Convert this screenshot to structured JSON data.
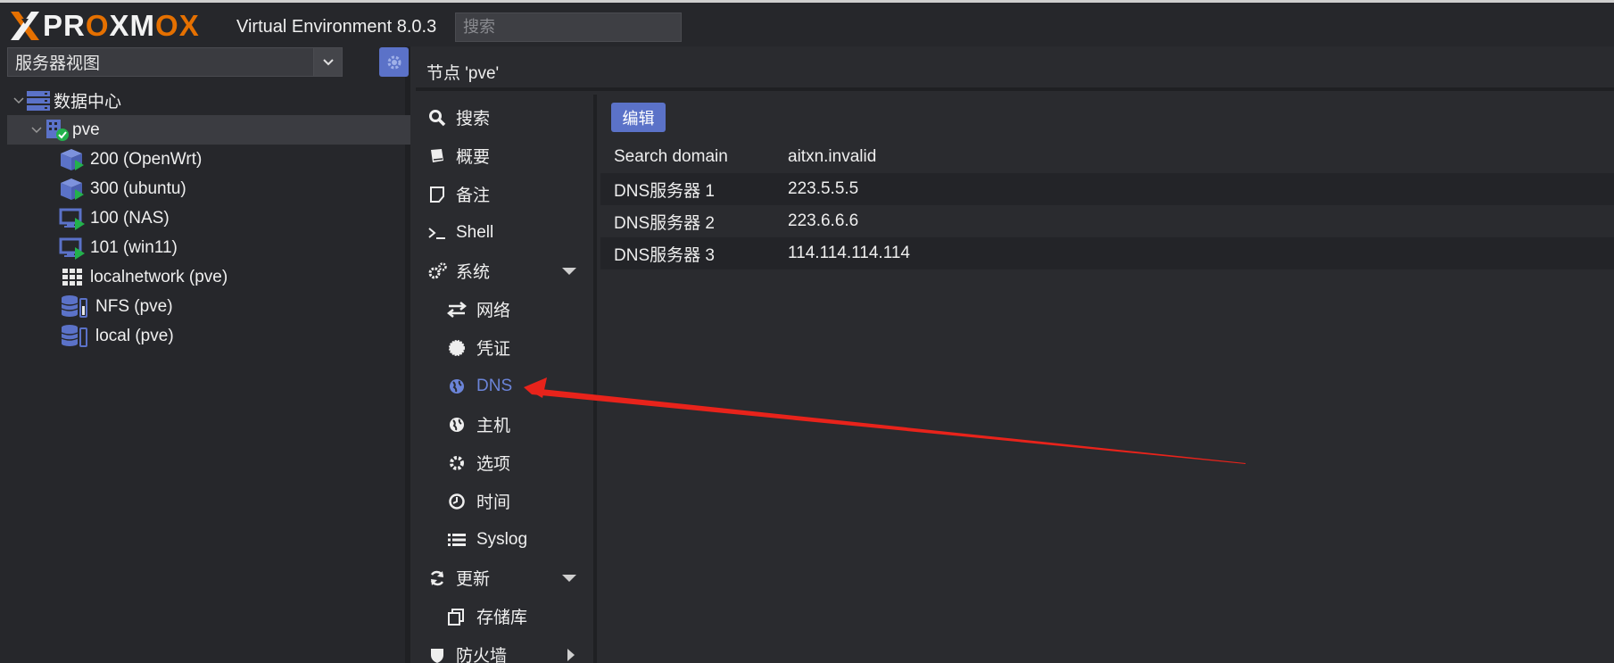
{
  "app": {
    "logo_text_pre": "PR",
    "logo_text_o1": "O",
    "logo_text_mid": "XM",
    "logo_text_o2": "O",
    "logo_text_x": "X",
    "version": "Virtual Environment 8.0.3",
    "search_placeholder": "搜索"
  },
  "sidebar": {
    "view_label": "服务器视图",
    "tree": [
      {
        "label": "数据中心",
        "icon": "datacenter-icon"
      },
      {
        "label": "pve",
        "icon": "node-online-icon"
      },
      {
        "label": "200 (OpenWrt)",
        "icon": "container-running-icon"
      },
      {
        "label": "300 (ubuntu)",
        "icon": "container-running-icon"
      },
      {
        "label": "100 (NAS)",
        "icon": "vm-running-icon"
      },
      {
        "label": "101 (win11)",
        "icon": "vm-running-icon"
      },
      {
        "label": "localnetwork (pve)",
        "icon": "sdn-grid-icon"
      },
      {
        "label": "NFS (pve)",
        "icon": "storage-icon"
      },
      {
        "label": "local (pve)",
        "icon": "storage-icon"
      }
    ]
  },
  "content": {
    "title": "节点 'pve'"
  },
  "nav": [
    {
      "label": "搜索",
      "icon": "search-icon"
    },
    {
      "label": "概要",
      "icon": "book-icon"
    },
    {
      "label": "备注",
      "icon": "note-icon"
    },
    {
      "label": "Shell",
      "icon": "terminal-icon"
    },
    {
      "label": "系统",
      "icon": "cogs-icon"
    },
    {
      "label": "网络",
      "icon": "exchange-icon"
    },
    {
      "label": "凭证",
      "icon": "certificate-icon"
    },
    {
      "label": "DNS",
      "icon": "globe-icon"
    },
    {
      "label": "主机",
      "icon": "globe-icon"
    },
    {
      "label": "选项",
      "icon": "gear-icon"
    },
    {
      "label": "时间",
      "icon": "clock-icon"
    },
    {
      "label": "Syslog",
      "icon": "list-icon"
    },
    {
      "label": "更新",
      "icon": "refresh-icon"
    },
    {
      "label": "存储库",
      "icon": "files-icon"
    },
    {
      "label": "防火墙",
      "icon": "shield-icon"
    }
  ],
  "dns": {
    "edit_label": "编辑",
    "rows": [
      {
        "key": "Search domain",
        "value": "aitxn.invalid"
      },
      {
        "key": "DNS服务器 1",
        "value": "223.5.5.5"
      },
      {
        "key": "DNS服务器 2",
        "value": "223.6.6.6"
      },
      {
        "key": "DNS服务器 3",
        "value": "114.114.114.114"
      }
    ]
  },
  "colors": {
    "accent": "#5b72c8",
    "active_nav": "#6b84d8",
    "brand_orange": "#e57000",
    "running_green": "#22b14c",
    "annotation_arrow": "#e8231b"
  }
}
